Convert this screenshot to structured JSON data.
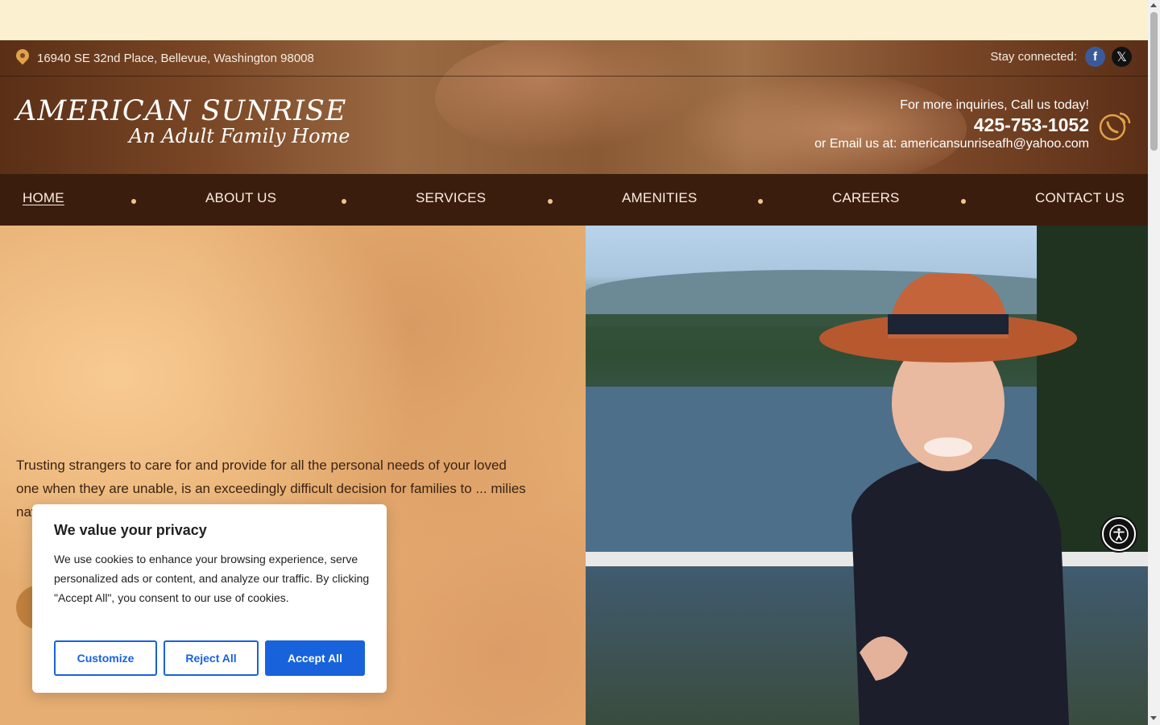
{
  "header": {
    "address": "16940 SE 32nd Place, Bellevue, Washington 98008",
    "stay_connected": "Stay connected:",
    "facebook_glyph": "f",
    "x_glyph": "𝕏",
    "logo_line1": "AMERICAN SUNRISE",
    "logo_line2": "An Adult Family Home",
    "inquiry": "For more inquiries, Call us today!",
    "phone": "425-753-1052",
    "email_line": "or Email us at: americansunriseafh@yahoo.com"
  },
  "nav": {
    "items": [
      {
        "label": "HOME",
        "active": true
      },
      {
        "label": "ABOUT US"
      },
      {
        "label": "SERVICES"
      },
      {
        "label": "AMENITIES"
      },
      {
        "label": "CAREERS"
      },
      {
        "label": "CONTACT US"
      }
    ]
  },
  "hero": {
    "text": "Trusting strangers to care for and provide for all the personal needs of your loved one when they are unable, is an exceedingly difficult decision for families to ... milies navigate thr..."
  },
  "cookie": {
    "title": "We value your privacy",
    "text": "We use cookies to enhance your browsing experience, serve personalized ads or content, and analyze our traffic. By clicking \"Accept All\", you consent to our use of cookies.",
    "customize": "Customize",
    "reject": "Reject All",
    "accept": "Accept All"
  },
  "colors": {
    "nav_bg": "#3b1d0e",
    "accent_blue": "#1863dc",
    "promo_strip": "#fbf1d1"
  },
  "icons": [
    "location-pin-icon",
    "facebook-icon",
    "x-twitter-icon",
    "phone-icon",
    "accessibility-icon"
  ]
}
